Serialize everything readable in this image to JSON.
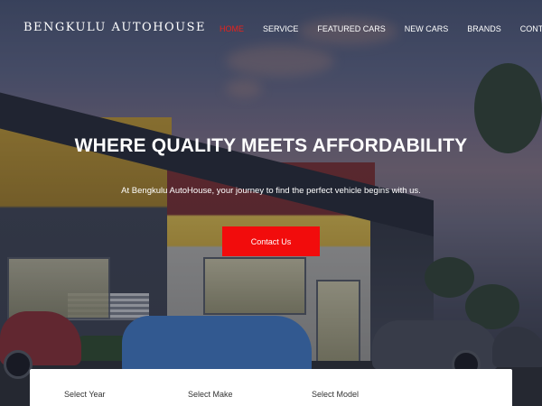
{
  "brand": {
    "name": "BENGKULU AUTOHOUSE"
  },
  "nav": {
    "items": [
      {
        "label": "HOME",
        "active": true
      },
      {
        "label": "SERVICE",
        "active": false
      },
      {
        "label": "FEATURED CARS",
        "active": false
      },
      {
        "label": "NEW CARS",
        "active": false
      },
      {
        "label": "BRANDS",
        "active": false
      },
      {
        "label": "CONTACT",
        "active": false
      }
    ]
  },
  "hero": {
    "title": "WHERE QUALITY MEETS AFFORDABILITY",
    "subtitle": "At Bengkulu AutoHouse, your journey to find the perfect vehicle begins with us.",
    "cta_label": "Contact Us"
  },
  "search": {
    "year_label": "Select Year",
    "make_label": "Select Make",
    "model_label": "Select Model"
  },
  "colors": {
    "accent": "#f20c0c",
    "active_nav": "#e8211c",
    "text_light": "#ffffff"
  }
}
